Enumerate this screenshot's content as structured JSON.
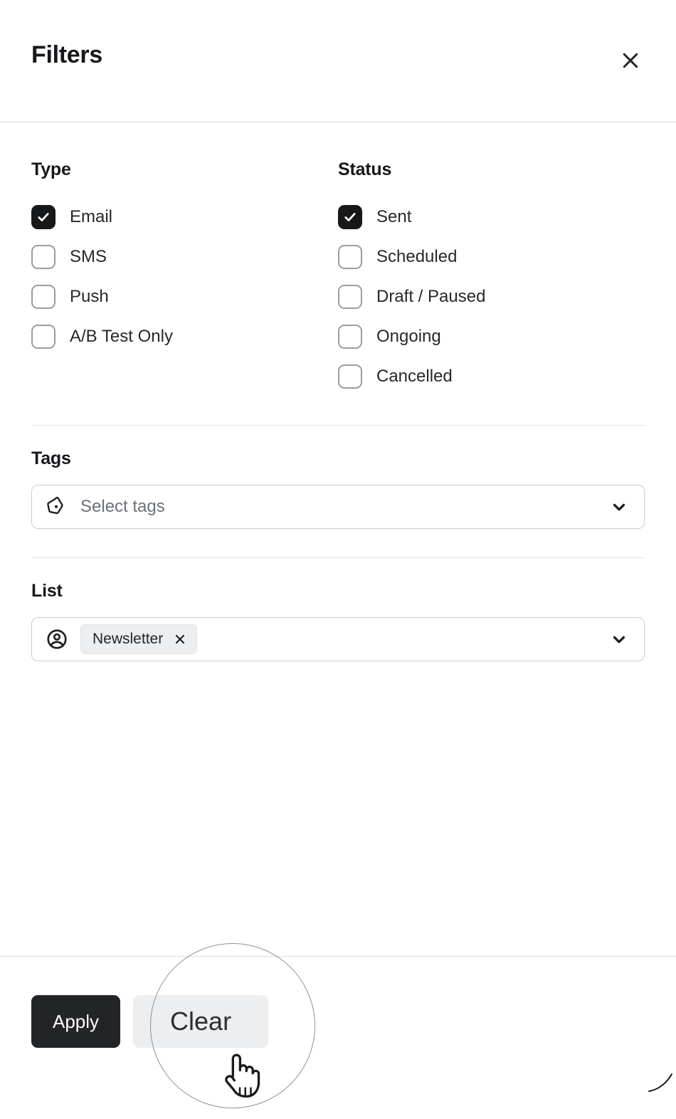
{
  "header": {
    "title": "Filters",
    "close_icon": "close-icon"
  },
  "groups": [
    {
      "title": "Type",
      "options": [
        {
          "label": "Email",
          "checked": true
        },
        {
          "label": "SMS",
          "checked": false
        },
        {
          "label": "Push",
          "checked": false
        },
        {
          "label": "A/B Test Only",
          "checked": false
        }
      ]
    },
    {
      "title": "Status",
      "options": [
        {
          "label": "Sent",
          "checked": true
        },
        {
          "label": "Scheduled",
          "checked": false
        },
        {
          "label": "Draft / Paused",
          "checked": false
        },
        {
          "label": "Ongoing",
          "checked": false
        },
        {
          "label": "Cancelled",
          "checked": false
        }
      ]
    }
  ],
  "tags_field": {
    "label": "Tags",
    "placeholder": "Select tags",
    "value": "",
    "leading_icon": "tag-icon",
    "trailing_icon": "chevron-down-icon"
  },
  "list_field": {
    "label": "List",
    "leading_icon": "user-circle-icon",
    "trailing_icon": "chevron-down-icon",
    "chips": [
      {
        "label": "Newsletter",
        "remove_icon": "close-icon"
      }
    ]
  },
  "footer": {
    "apply_label": "Apply",
    "clear_label": "Clear"
  },
  "colors": {
    "accent": "#222427",
    "checkbox_checked": "#17181a",
    "checkbox_border": "#9a9da1",
    "chip_background": "#eceef0",
    "secondary_button": "#eceef0",
    "border": "#c9ccd0",
    "divider": "#e3e5e7",
    "text": "#1f2124",
    "placeholder": "#6d7176"
  },
  "overlay": {
    "lens_shape": "zoom-lens-circle",
    "cursor_icon": "hand-pointer-cursor"
  }
}
